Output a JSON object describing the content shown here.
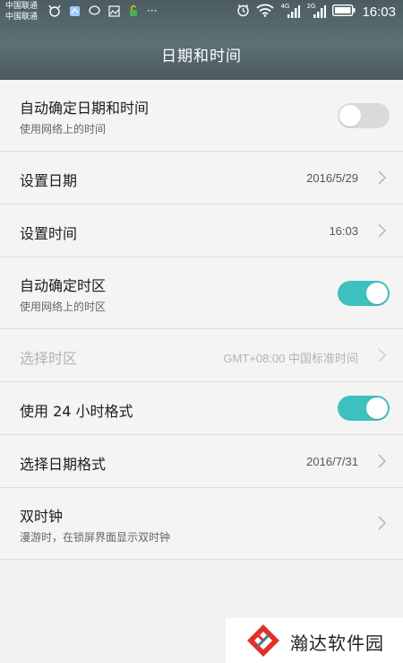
{
  "status_bar": {
    "carrier_1": "中国联通",
    "carrier_2": "中国联通",
    "network_1": "4G",
    "network_2": "2G",
    "time": "16:03",
    "more": "···"
  },
  "header": {
    "title": "日期和时间"
  },
  "settings": [
    {
      "label": "自动确定日期和时间",
      "sub": "使用网络上的时间",
      "toggle": "off"
    },
    {
      "label": "设置日期",
      "value": "2016/5/29"
    },
    {
      "label": "设置时间",
      "value": "16:03"
    },
    {
      "label": "自动确定时区",
      "sub": "使用网络上的时区",
      "toggle": "on"
    },
    {
      "label": "选择时区",
      "value": "GMT+08:00 中国标准时间",
      "disabled": true
    },
    {
      "label": "使用 24 小时格式",
      "toggle": "on"
    },
    {
      "label": "选择日期格式",
      "value": "2016/7/31"
    },
    {
      "label": "双时钟",
      "sub": "漫游时，在锁屏界面显示双时钟"
    }
  ],
  "watermark": {
    "text": "瀚达软件园"
  },
  "colors": {
    "accent": "#3ec0c0",
    "header": "#566a6f",
    "background": "#f2f2f2"
  }
}
